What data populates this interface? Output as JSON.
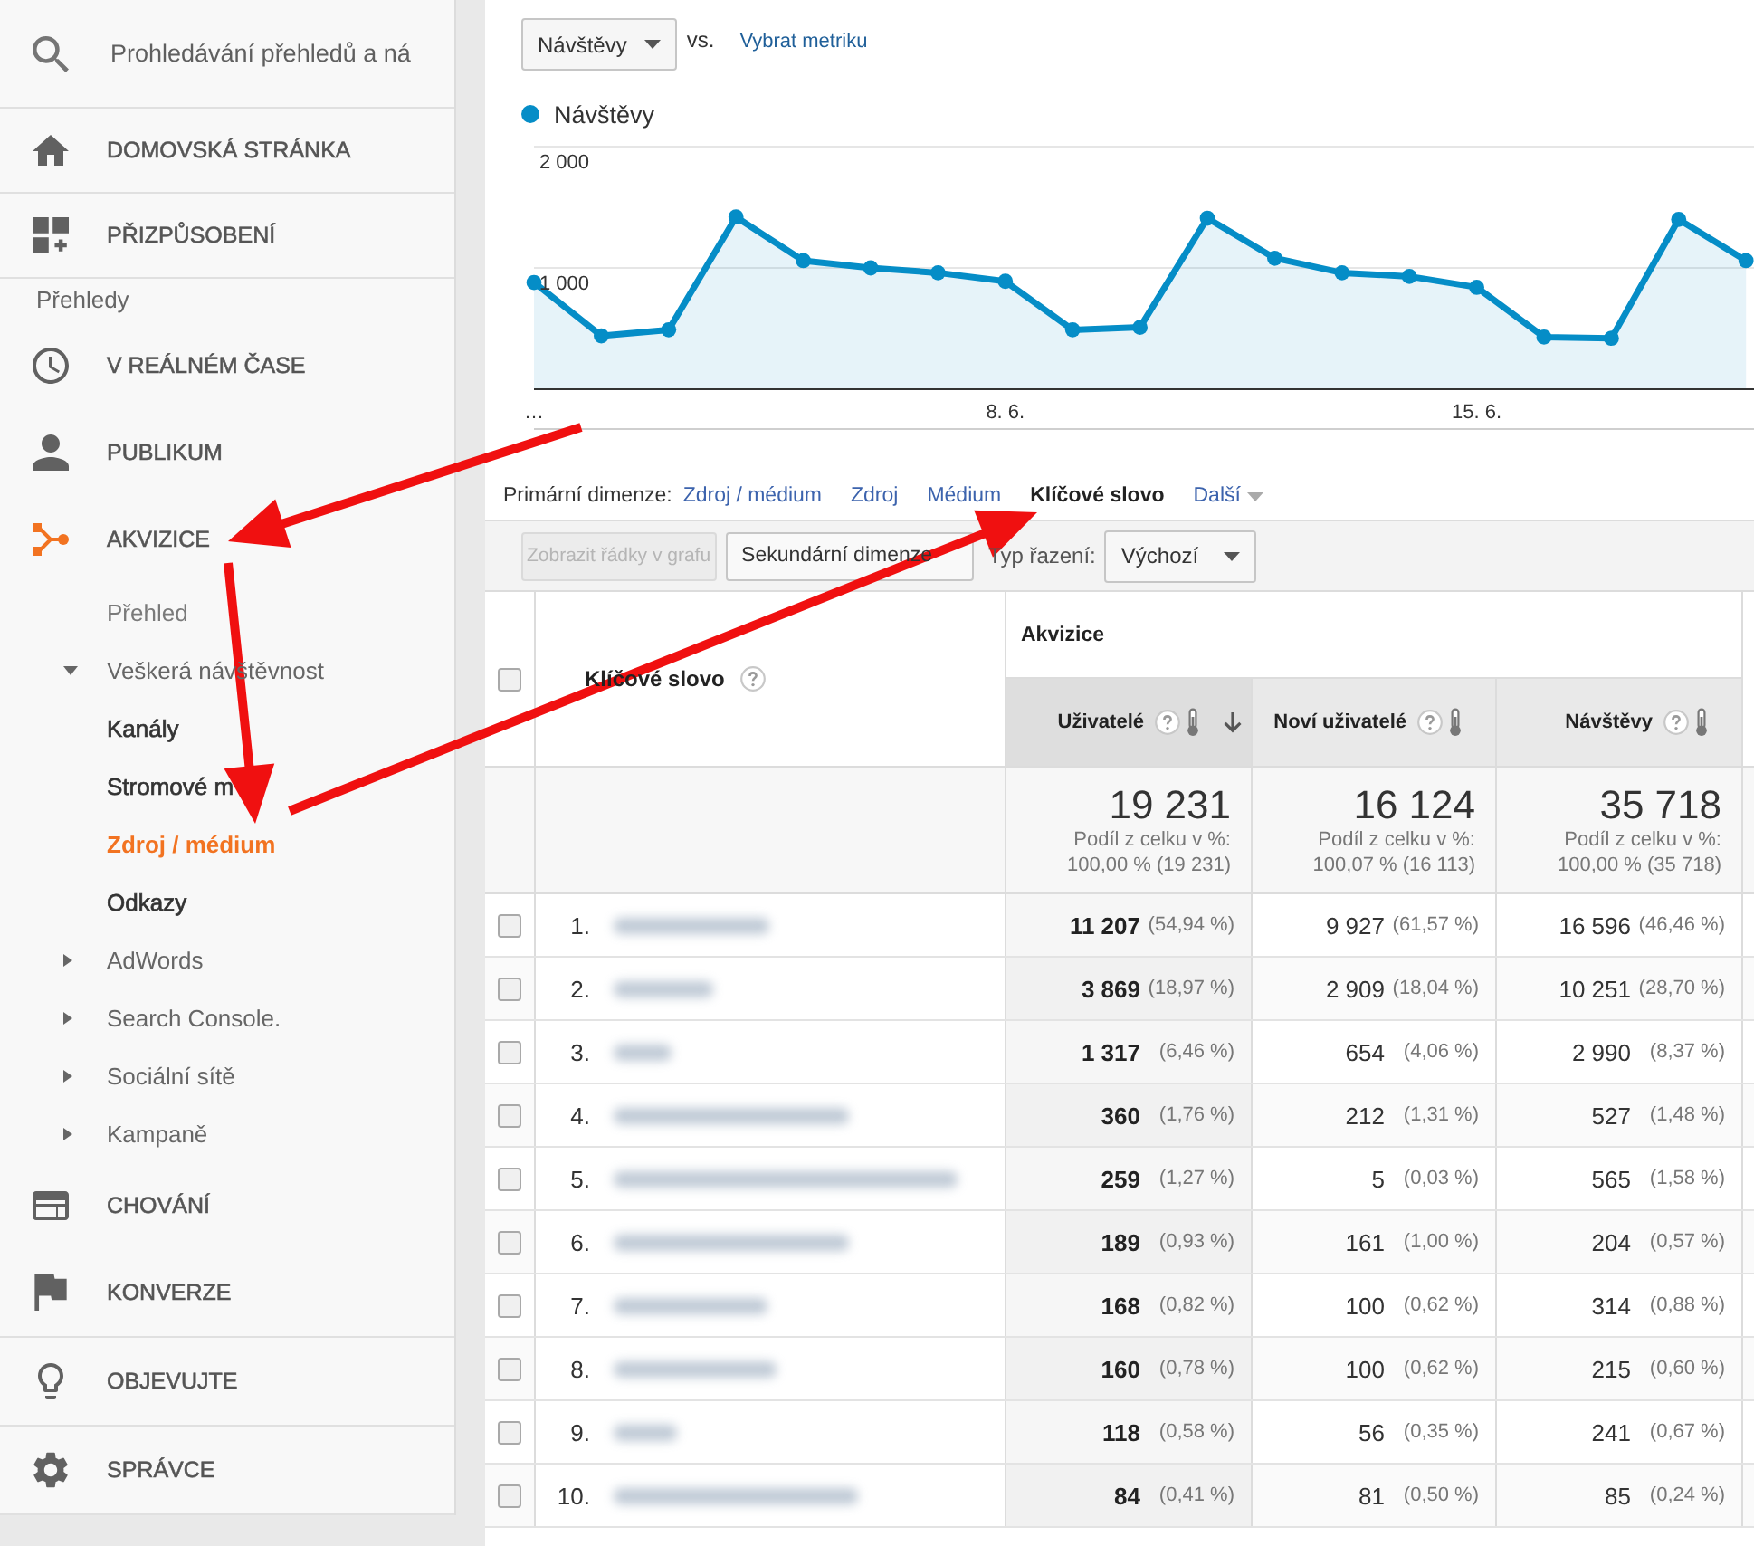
{
  "sidebar": {
    "search": {
      "placeholder": "Prohledávání přehledů a ná"
    },
    "top_items": [
      {
        "label": "DOMOVSKÁ STRÁNKA",
        "selected": false
      },
      {
        "label": "PŘIZPŮSOBENÍ",
        "selected": false
      }
    ],
    "section_label": "Přehledy",
    "reports": [
      {
        "label": "V REÁLNÉM ČASE",
        "selected": false
      },
      {
        "label": "PUBLIKUM",
        "selected": false
      },
      {
        "label": "AKVIZICE",
        "selected": true,
        "children": [
          {
            "kind": "link",
            "label": "Přehled",
            "selected": false
          },
          {
            "kind": "group",
            "label": "Veškerá návštěvnost",
            "expanded": true,
            "selected": false,
            "children": [
              {
                "label": "Kanály",
                "selected": false
              },
              {
                "label": "Stromové m",
                "selected": false
              },
              {
                "label": "Zdroj / médium",
                "selected": true
              },
              {
                "label": "Odkazy",
                "selected": false
              }
            ]
          },
          {
            "kind": "group",
            "label": "AdWords",
            "expanded": false,
            "selected": false
          },
          {
            "kind": "group",
            "label": "Search Console.",
            "expanded": false,
            "selected": false
          },
          {
            "kind": "group",
            "label": "Sociální sítě",
            "expanded": false,
            "selected": false
          },
          {
            "kind": "group",
            "label": "Kampaně",
            "expanded": false,
            "selected": false
          }
        ]
      },
      {
        "label": "CHOVÁNÍ",
        "selected": false
      },
      {
        "label": "KONVERZE",
        "selected": false
      }
    ],
    "bottom_items": [
      {
        "label": "OBJEVUJTE",
        "selected": false
      },
      {
        "label": "SPRÁVCE",
        "selected": false
      }
    ]
  },
  "main": {
    "metric_picker": {
      "value": "Návštěvy"
    },
    "vs_label": "vs.",
    "compare_link": "Vybrat metriku",
    "chart": {
      "chart_data": {
        "type": "area",
        "categories": [
          "…",
          null,
          null,
          null,
          null,
          null,
          null,
          "8. 6.",
          null,
          null,
          null,
          null,
          null,
          null,
          "15. 6.",
          null,
          null,
          null,
          null
        ],
        "ylim": [
          0,
          2000
        ],
        "yticks": [
          {
            "value": 1000,
            "label": "1 000"
          },
          {
            "value": 2000,
            "label": "2 000"
          }
        ],
        "series": [
          {
            "name": "Návštěvy",
            "color": "#058dc7",
            "values": [
              880,
              440,
              490,
              1420,
              1060,
              1000,
              960,
              890,
              490,
              510,
              1410,
              1080,
              960,
              930,
              840,
              430,
              420,
              1400,
              1060
            ]
          }
        ]
      }
    },
    "primary_dimension": {
      "label": "Primární dimenze:",
      "options": [
        {
          "label": "Zdroj / médium",
          "selected": false
        },
        {
          "label": "Zdroj",
          "selected": false
        },
        {
          "label": "Médium",
          "selected": false
        },
        {
          "label": "Klíčové slovo",
          "selected": true
        }
      ],
      "more": "Další"
    },
    "toolbar": {
      "plot_rows_button": {
        "label": "Zobrazit řádky v grafu",
        "disabled": true
      },
      "secondary_dimension_button": {
        "label": "Sekundární dimenze"
      },
      "sort_label": "Typ řazení:",
      "sort_select": {
        "value": "Výchozí"
      }
    },
    "table": {
      "select_all": {
        "checked": false
      },
      "dimension_header": "Klíčové slovo",
      "group_header": "Akvizice",
      "columns": [
        {
          "label": "Uživatelé",
          "sorted": true
        },
        {
          "label": "Noví uživatelé",
          "sorted": false
        },
        {
          "label": "Návštěvy",
          "sorted": false
        }
      ],
      "totals": [
        {
          "value": "19 231",
          "share_label": "Podíl z celku v %:",
          "share": "100,00 % (19 231)"
        },
        {
          "value": "16 124",
          "share_label": "Podíl z celku v %:",
          "share": "100,07 % (16 113)"
        },
        {
          "value": "35 718",
          "share_label": "Podíl z celku v %:",
          "share": "100,00 % (35 718)"
        }
      ],
      "rows": [
        {
          "index": "1.",
          "checked": false,
          "cells": [
            {
              "value": "11 207",
              "percent": "(54,94 %)"
            },
            {
              "value": "9 927",
              "percent": "(61,57 %)"
            },
            {
              "value": "16 596",
              "percent": "(46,46 %)"
            }
          ]
        },
        {
          "index": "2.",
          "checked": false,
          "cells": [
            {
              "value": "3 869",
              "percent": "(18,97 %)"
            },
            {
              "value": "2 909",
              "percent": "(18,04 %)"
            },
            {
              "value": "10 251",
              "percent": "(28,70 %)"
            }
          ]
        },
        {
          "index": "3.",
          "checked": false,
          "cells": [
            {
              "value": "1 317",
              "percent": "(6,46 %)"
            },
            {
              "value": "654",
              "percent": "(4,06 %)"
            },
            {
              "value": "2 990",
              "percent": "(8,37 %)"
            }
          ]
        },
        {
          "index": "4.",
          "checked": false,
          "cells": [
            {
              "value": "360",
              "percent": "(1,76 %)"
            },
            {
              "value": "212",
              "percent": "(1,31 %)"
            },
            {
              "value": "527",
              "percent": "(1,48 %)"
            }
          ]
        },
        {
          "index": "5.",
          "checked": false,
          "cells": [
            {
              "value": "259",
              "percent": "(1,27 %)"
            },
            {
              "value": "5",
              "percent": "(0,03 %)"
            },
            {
              "value": "565",
              "percent": "(1,58 %)"
            }
          ]
        },
        {
          "index": "6.",
          "checked": false,
          "cells": [
            {
              "value": "189",
              "percent": "(0,93 %)"
            },
            {
              "value": "161",
              "percent": "(1,00 %)"
            },
            {
              "value": "204",
              "percent": "(0,57 %)"
            }
          ]
        },
        {
          "index": "7.",
          "checked": false,
          "cells": [
            {
              "value": "168",
              "percent": "(0,82 %)"
            },
            {
              "value": "100",
              "percent": "(0,62 %)"
            },
            {
              "value": "314",
              "percent": "(0,88 %)"
            }
          ]
        },
        {
          "index": "8.",
          "checked": false,
          "cells": [
            {
              "value": "160",
              "percent": "(0,78 %)"
            },
            {
              "value": "100",
              "percent": "(0,62 %)"
            },
            {
              "value": "215",
              "percent": "(0,60 %)"
            }
          ]
        },
        {
          "index": "9.",
          "checked": false,
          "cells": [
            {
              "value": "118",
              "percent": "(0,58 %)"
            },
            {
              "value": "56",
              "percent": "(0,35 %)"
            },
            {
              "value": "241",
              "percent": "(0,67 %)"
            }
          ]
        },
        {
          "index": "10.",
          "checked": false,
          "cells": [
            {
              "value": "84",
              "percent": "(0,41 %)"
            },
            {
              "value": "81",
              "percent": "(0,50 %)"
            },
            {
              "value": "85",
              "percent": "(0,24 %)"
            }
          ]
        }
      ]
    }
  }
}
